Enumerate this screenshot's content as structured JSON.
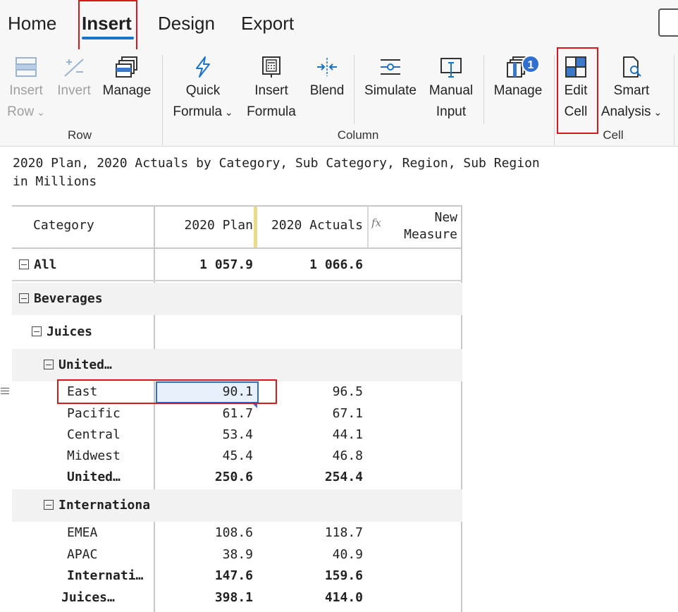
{
  "tabs": [
    {
      "label": "Home"
    },
    {
      "label": "Insert"
    },
    {
      "label": "Design"
    },
    {
      "label": "Export"
    }
  ],
  "ribbon": {
    "insert_row": {
      "line1": "Insert",
      "line2": "Row"
    },
    "invert": {
      "line1": "Invert"
    },
    "manage_row": {
      "line1": "Manage"
    },
    "quick_formula": {
      "line1": "Quick",
      "line2": "Formula"
    },
    "insert_formula": {
      "line1": "Insert",
      "line2": "Formula"
    },
    "blend": {
      "line1": "Blend"
    },
    "simulate": {
      "line1": "Simulate"
    },
    "manual_input": {
      "line1": "Manual",
      "line2": "Input"
    },
    "manage_col": {
      "line1": "Manage",
      "badge": "1"
    },
    "edit_cell": {
      "line1": "Edit",
      "line2": "Cell"
    },
    "smart_analysis": {
      "line1": "Smart",
      "line2": "Analysis"
    },
    "groups": {
      "row": "Row",
      "column": "Column",
      "cell": "Cell"
    }
  },
  "report": {
    "title": "2020 Plan, 2020 Actuals by Category, Sub Category, Region, Sub Region",
    "subtitle": "in Millions"
  },
  "grid": {
    "headers": {
      "category": "Category",
      "plan": "2020 Plan",
      "actuals": "2020 Actuals",
      "new_measure_1": "New",
      "new_measure_2": "Measure",
      "fx": "fx"
    },
    "rows": [
      {
        "label": "All",
        "plan": "1 057.9",
        "actuals": "1 066.6"
      },
      {
        "label": "Beverages",
        "plan": "",
        "actuals": ""
      },
      {
        "label": "Juices",
        "plan": "",
        "actuals": ""
      },
      {
        "label": "United…",
        "plan": "",
        "actuals": ""
      },
      {
        "label": "East",
        "plan": "90.1",
        "actuals": "96.5"
      },
      {
        "label": "Pacific",
        "plan": "61.7",
        "actuals": "67.1"
      },
      {
        "label": "Central",
        "plan": "53.4",
        "actuals": "44.1"
      },
      {
        "label": "Midwest",
        "plan": "45.4",
        "actuals": "46.8"
      },
      {
        "label": "United…",
        "plan": "250.6",
        "actuals": "254.4"
      },
      {
        "label": "Internationa",
        "plan": "",
        "actuals": ""
      },
      {
        "label": "EMEA",
        "plan": "108.6",
        "actuals": "118.7"
      },
      {
        "label": "APAC",
        "plan": "38.9",
        "actuals": "40.9"
      },
      {
        "label": "Internati…",
        "plan": "147.6",
        "actuals": "159.6"
      },
      {
        "label": "Juices…",
        "plan": "398.1",
        "actuals": "414.0"
      }
    ]
  },
  "colors": {
    "accent": "#1a73c8",
    "highlight": "#d7191c",
    "selection": "#2f6fcf"
  }
}
